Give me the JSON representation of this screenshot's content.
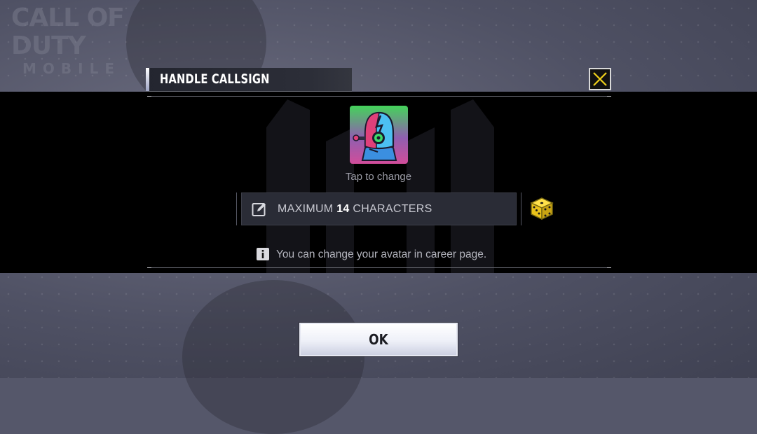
{
  "game": {
    "logo_line1": "CALL OF DUTY",
    "logo_line2": "MOBILE"
  },
  "dialog": {
    "title": "HANDLE CALLSIGN",
    "avatar_hint": "Tap to change",
    "name_input": {
      "placeholder_prefix": "MAXIMUM ",
      "placeholder_number": "14",
      "placeholder_suffix": " CHARACTERS",
      "value": ""
    },
    "info_text": "You can change your avatar in career page.",
    "ok_label": "OK"
  },
  "icons": {
    "close": "close-icon",
    "edit": "pencil-icon",
    "random": "dice-icon",
    "info": "info-icon",
    "avatar": "robot-avatar"
  },
  "colors": {
    "accent_yellow": "#f2d21b",
    "band": "#000000",
    "field_bg": "#2a2c36"
  }
}
